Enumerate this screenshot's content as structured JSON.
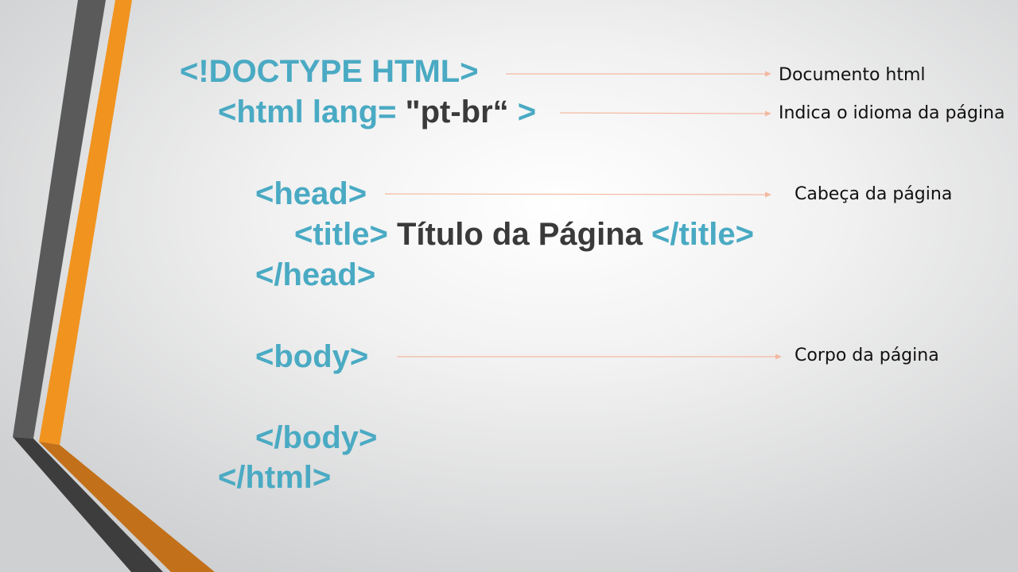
{
  "colors": {
    "tag": "#4aaac3",
    "text": "#3a3a3a",
    "annotation": "#111111",
    "arrow": "#f4b9a0",
    "stripe_dark": "#555555",
    "stripe_orange": "#f0931f"
  },
  "code": {
    "doctype": "<!DOCTYPE HTML>",
    "html_open_tag": "<html lang=",
    "html_lang_value": "\"pt-br“",
    "html_open_close": ">",
    "head_open": "<head>",
    "title_open": "<title>",
    "title_text": "Título da Página",
    "title_close": "</title>",
    "head_close": "</head>",
    "body_open": "<body>",
    "body_close": "</body>",
    "html_close": "</html>"
  },
  "annotations": {
    "doctype": "Documento html",
    "html_lang": "Indica o idioma da página",
    "head": "Cabeça da página",
    "body": "Corpo da página"
  }
}
